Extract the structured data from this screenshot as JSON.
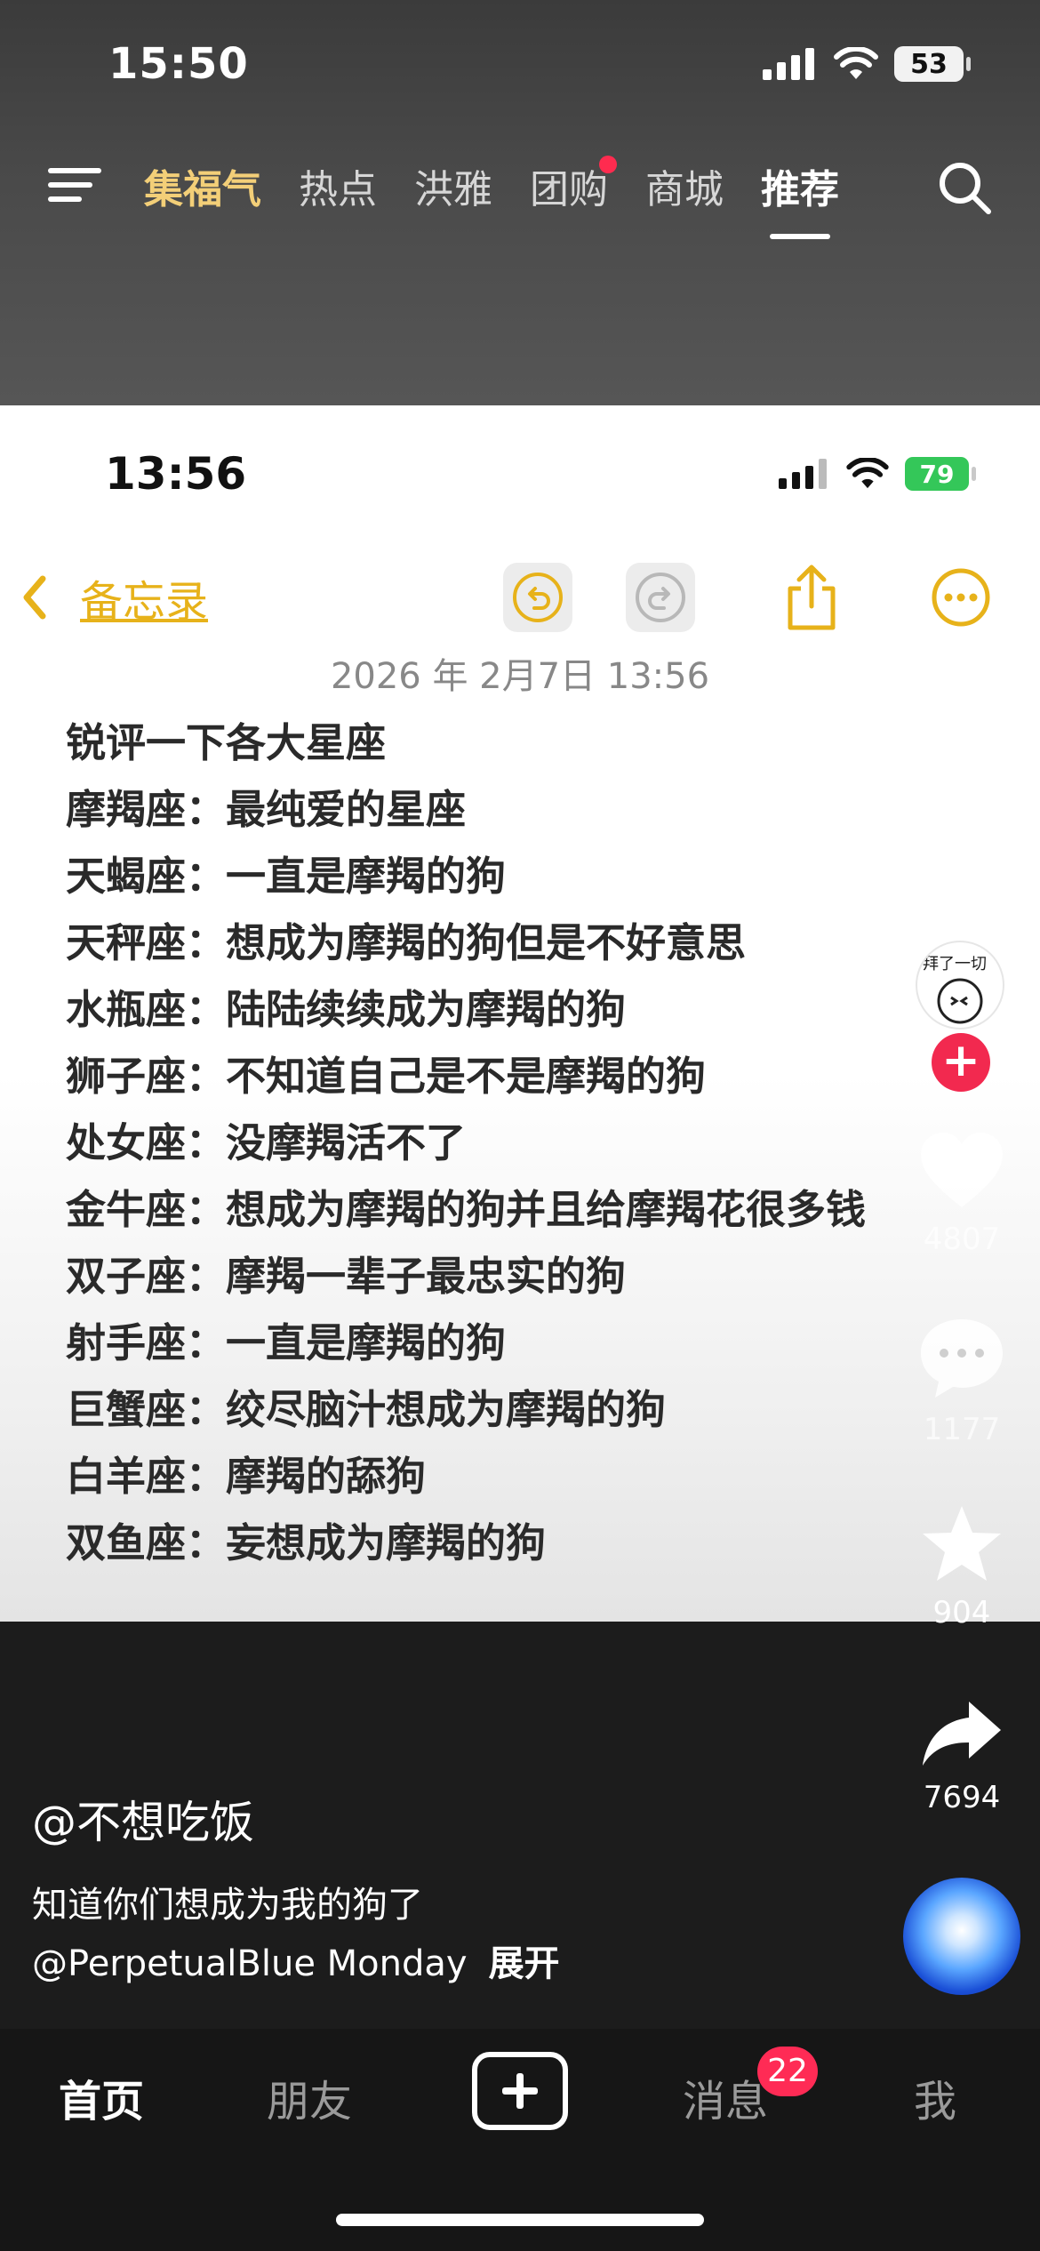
{
  "status_bar": {
    "time": "15:50",
    "battery": "53"
  },
  "top_nav": {
    "tabs": [
      {
        "label": "集福气",
        "style": "gold"
      },
      {
        "label": "热点",
        "style": "normal"
      },
      {
        "label": "洪雅",
        "style": "normal"
      },
      {
        "label": "团购",
        "style": "normal",
        "dot": true
      },
      {
        "label": "商城",
        "style": "normal"
      },
      {
        "label": "推荐",
        "style": "active"
      }
    ]
  },
  "embedded": {
    "status": {
      "time": "13:56",
      "battery": "79"
    },
    "notes_bar": {
      "back_label": "备忘录"
    },
    "date": "2026 年 2月7日 13:56",
    "note_lines": [
      "锐评一下各大星座",
      "摩羯座：最纯爱的星座",
      "天蝎座：一直是摩羯的狗",
      "天秤座：想成为摩羯的狗但是不好意思",
      "水瓶座：陆陆续续成为摩羯的狗",
      "狮子座：不知道自己是不是摩羯的狗",
      "处女座：没摩羯活不了",
      "金牛座：想成为摩羯的狗并且给摩羯花很多钱",
      "双子座：摩羯一辈子最忠实的狗",
      "射手座：一直是摩羯的狗",
      "巨蟹座：绞尽脑汁想成为摩羯的狗",
      "白羊座：摩羯的舔狗",
      "双鱼座：妄想成为摩羯的狗"
    ]
  },
  "rail": {
    "avatar_text": "拜了一切",
    "likes": "4807",
    "comments": "1177",
    "favorites": "904",
    "shares": "7694"
  },
  "post": {
    "author": "@不想吃饭",
    "caption": "知道你们想成为我的狗了",
    "mention": "@PerpetualBlue Monday",
    "expand": "展开"
  },
  "tabbar": {
    "home": "首页",
    "friends": "朋友",
    "messages": "消息",
    "messages_badge": "22",
    "me": "我"
  },
  "colors": {
    "accent_gold": "#f3cf78",
    "notes_yellow": "#e7b21a",
    "badge_red": "#ff2b55",
    "battery_green": "#34c759"
  }
}
